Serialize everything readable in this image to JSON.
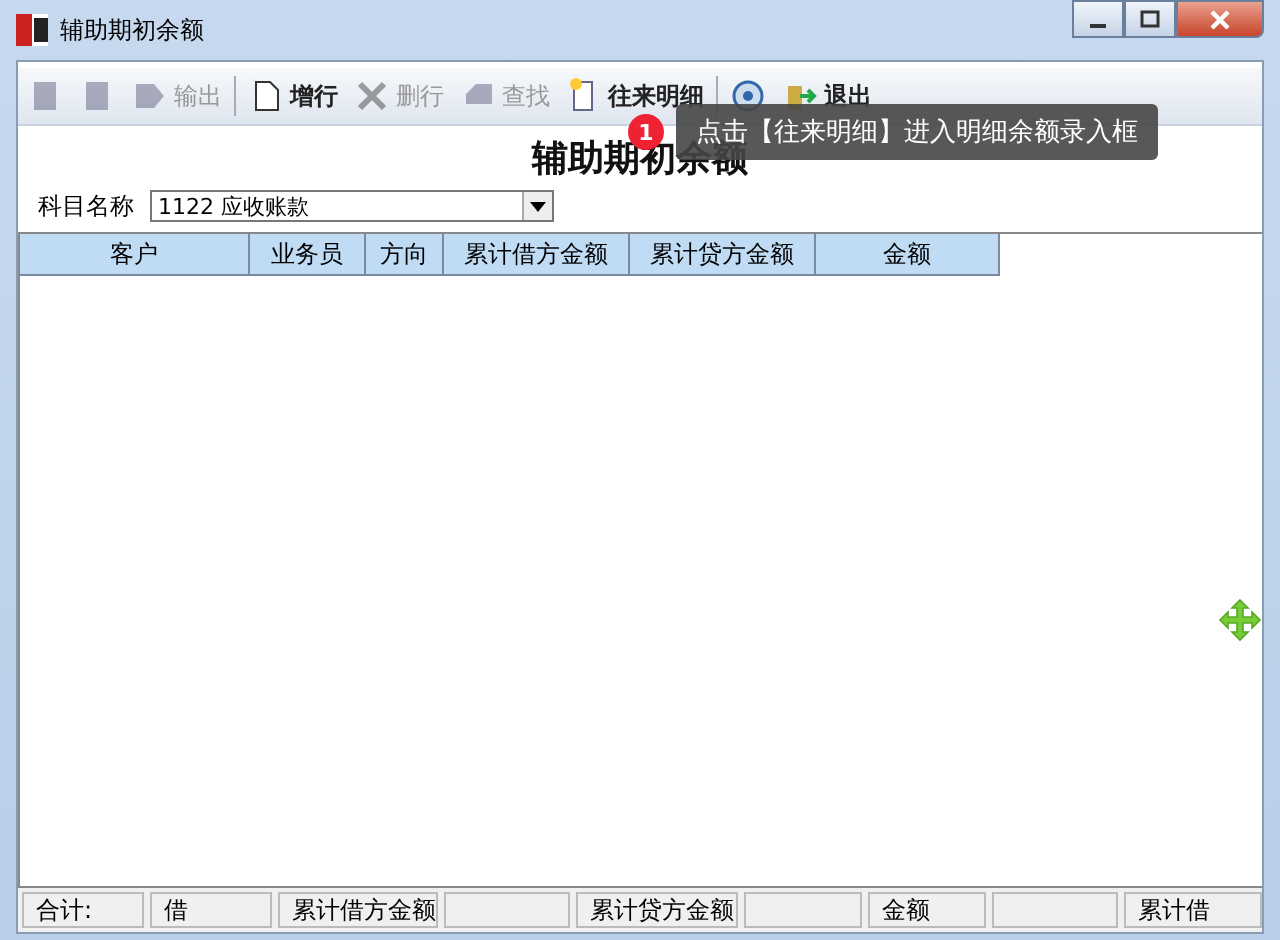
{
  "window": {
    "title": "辅助期初余额"
  },
  "toolbar": [
    {
      "kind": "button",
      "disabled": true
    },
    {
      "kind": "button",
      "disabled": true
    },
    {
      "kind": "button",
      "label": "输出",
      "disabled": true
    },
    {
      "kind": "separator"
    },
    {
      "kind": "button",
      "label": "增行",
      "disabled": false
    },
    {
      "kind": "button",
      "label": "删行",
      "disabled": true
    },
    {
      "kind": "button",
      "label": "查找",
      "disabled": true
    },
    {
      "kind": "button",
      "label": "往来明细",
      "disabled": false
    },
    {
      "kind": "separator"
    },
    {
      "kind": "button",
      "disabled": false
    },
    {
      "kind": "button",
      "label": "退出",
      "disabled": false
    }
  ],
  "tooltip": {
    "step": "1",
    "text": "点击【往来明细】进入明细余额录入框"
  },
  "heading": "辅助期初余额",
  "subject": {
    "label": "科目名称",
    "value": "1122 应收账款"
  },
  "table": {
    "columns": [
      "客户",
      "业务员",
      "方向",
      "累计借方金额",
      "累计贷方金额",
      "金额"
    ]
  },
  "status_bar": [
    {
      "kind": "label",
      "text": "合计:"
    },
    {
      "kind": "label",
      "text": "借"
    },
    {
      "kind": "label",
      "text": "累计借方金额"
    },
    {
      "kind": "field"
    },
    {
      "kind": "label",
      "text": "累计贷方金额"
    },
    {
      "kind": "field"
    },
    {
      "kind": "label",
      "text": "金额"
    },
    {
      "kind": "field"
    },
    {
      "kind": "label",
      "text": "累计借"
    }
  ]
}
